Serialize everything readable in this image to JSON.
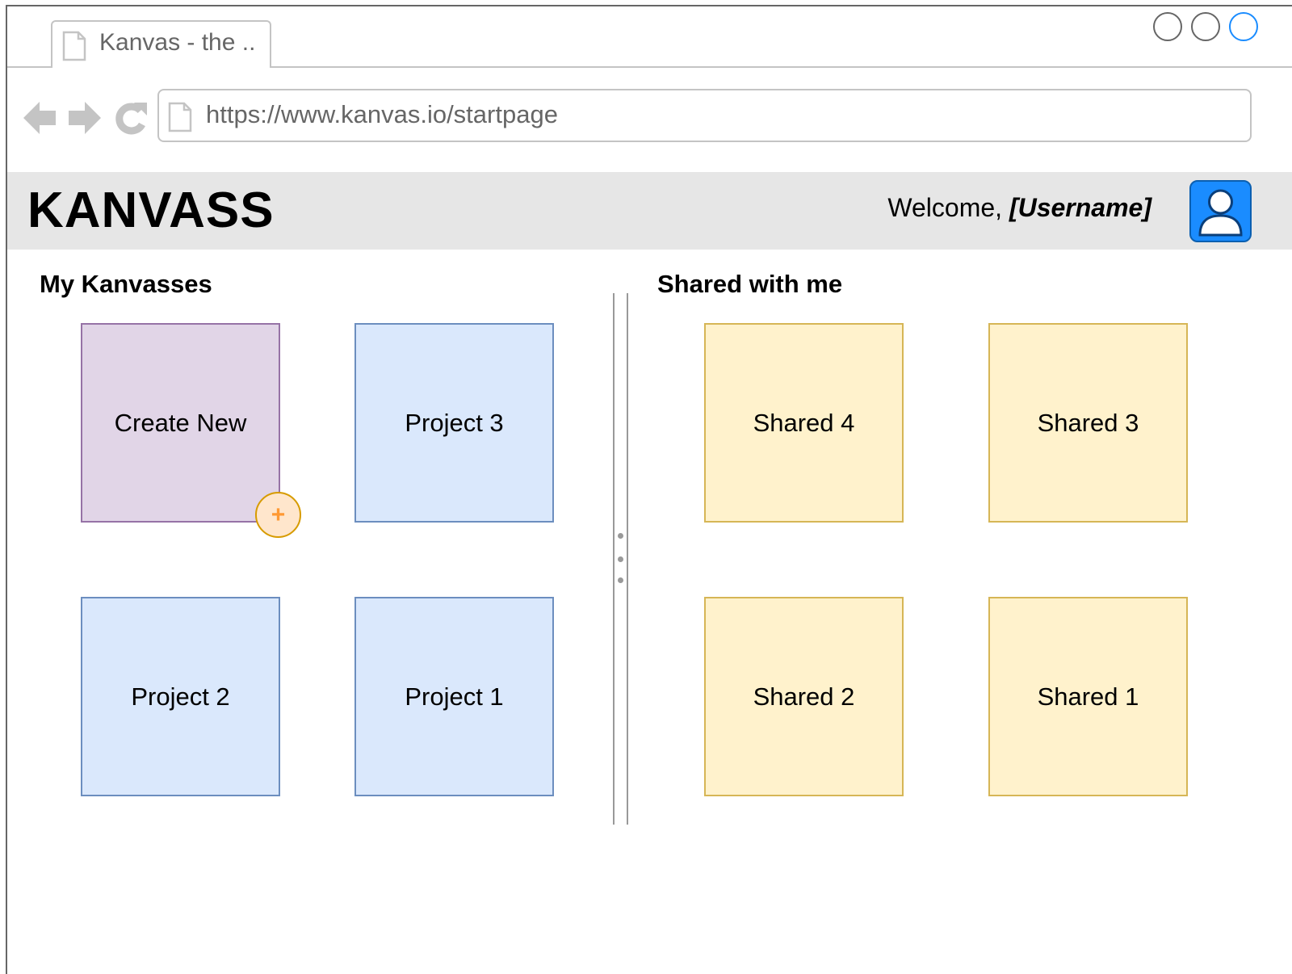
{
  "browser": {
    "tab_title": "Kanvas - the ..",
    "url": "https://www.kanvas.io/startpage",
    "accent_color": "#1a8cff"
  },
  "header": {
    "logo": "KANVASS",
    "welcome_prefix": "Welcome, ",
    "username": "[Username]",
    "avatar_icon": "user-icon"
  },
  "my_kanvasses": {
    "title": "My Kanvasses",
    "create_label": "Create New",
    "add_symbol": "+",
    "projects": [
      "Project 3",
      "Project 2",
      "Project 1"
    ]
  },
  "shared": {
    "title": "Shared with me",
    "items": [
      "Shared 4",
      "Shared 3",
      "Shared 2",
      "Shared 1"
    ]
  },
  "colors": {
    "create_fill": "#e1d5e7",
    "project_fill": "#dae8fc",
    "shared_fill": "#fff2cc",
    "header_bg": "#e6e6e6"
  }
}
